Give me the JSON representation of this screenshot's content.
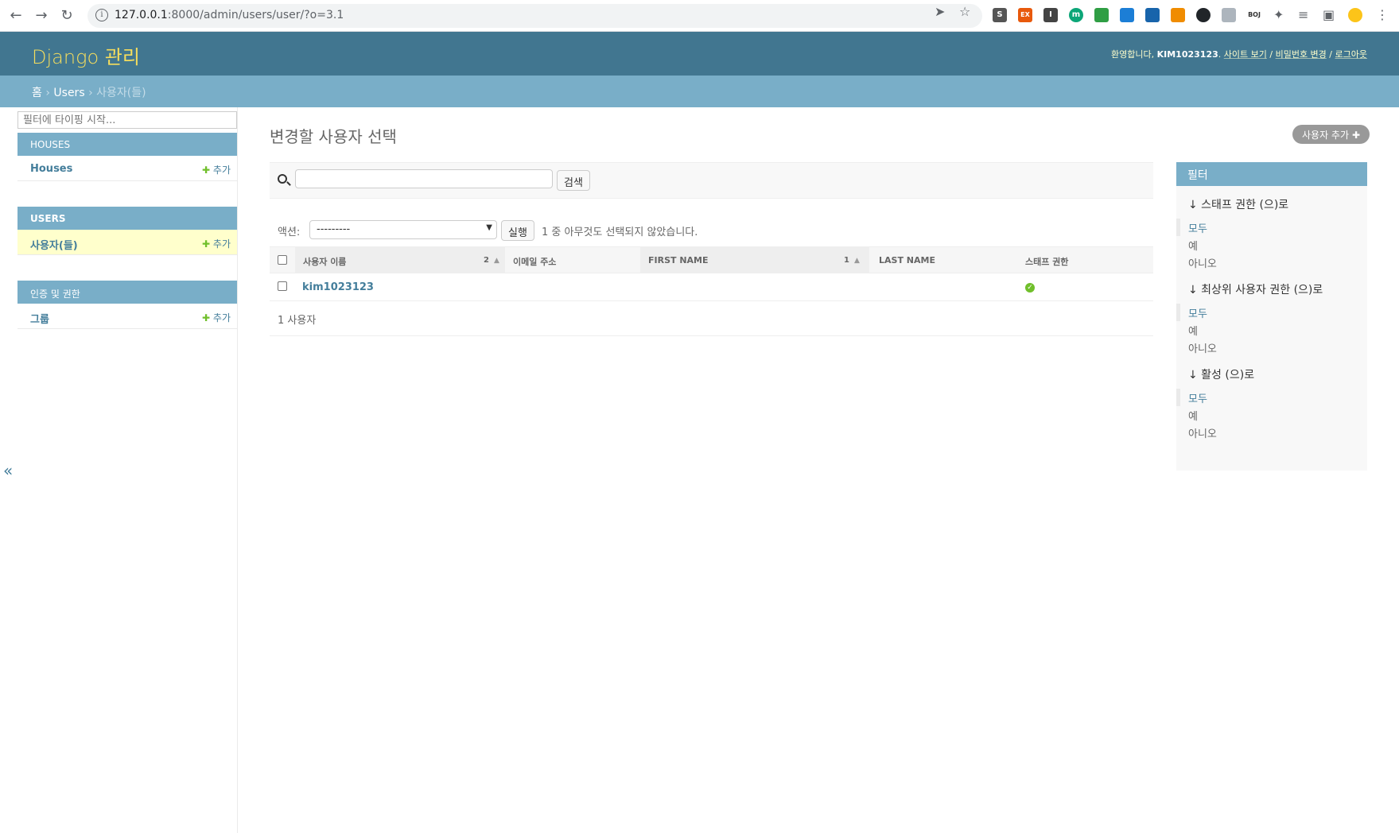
{
  "browser": {
    "url_host": "127.0.0.1",
    "url_rest": ":8000/admin/users/user/?o=3.1",
    "extensions": [
      "S",
      "EX",
      "I",
      "m",
      "",
      "",
      "",
      "",
      "",
      "",
      "BOJ"
    ]
  },
  "header": {
    "branding": "Django 관리",
    "welcome": "환영합니다,",
    "username": "KIM1023123",
    "view_site": "사이트 보기",
    "change_password": "비밀번호 변경",
    "logout": "로그아웃",
    "sep": "/"
  },
  "breadcrumbs": {
    "home": "홈",
    "app": "Users",
    "current": "사용자(들)",
    "sep": "›"
  },
  "sidebar": {
    "filter_placeholder": "필터에 타이핑 시작...",
    "toggle": "«",
    "modules": [
      {
        "caption": "HOUSES",
        "model": "Houses",
        "add": "추가"
      },
      {
        "caption": "USERS",
        "model": "사용자(들)",
        "add": "추가"
      },
      {
        "caption": "인증 및 권한",
        "model": "그룹",
        "add": "추가"
      }
    ]
  },
  "main": {
    "title": "변경할 사용자 선택",
    "add_button": "사용자 추가",
    "search_button": "검색",
    "action_label": "액션:",
    "action_value": "---------",
    "run_button": "실행",
    "selection_counter": "1 중 아무것도 선택되지 않았습니다.",
    "columns": [
      {
        "label": "사용자 이름",
        "sort": "2"
      },
      {
        "label": "이메일 주소",
        "sort": ""
      },
      {
        "label": "FIRST NAME",
        "sort": "1"
      },
      {
        "label": "LAST NAME",
        "sort": ""
      },
      {
        "label": "스태프 권한",
        "sort": ""
      }
    ],
    "rows": [
      {
        "username": "kim1023123",
        "email": "",
        "first_name": "",
        "last_name": "",
        "is_staff": true
      }
    ],
    "paginator": "1 사용자"
  },
  "filter": {
    "title": "필터",
    "groups": [
      {
        "heading": "↓ 스태프 권한 (으)로",
        "options": [
          "모두",
          "예",
          "아니오"
        ]
      },
      {
        "heading": "↓ 최상위 사용자 권한 (으)로",
        "options": [
          "모두",
          "예",
          "아니오"
        ]
      },
      {
        "heading": "↓ 활성 (으)로",
        "options": [
          "모두",
          "예",
          "아니오"
        ]
      }
    ]
  },
  "colors": {
    "header_bg": "#417690",
    "breadcrumb_bg": "#79aec8",
    "brand_yellow": "#f5dd5d",
    "link": "#447e9b",
    "add_green": "#70bf2b",
    "current_row": "#ffffcc"
  }
}
